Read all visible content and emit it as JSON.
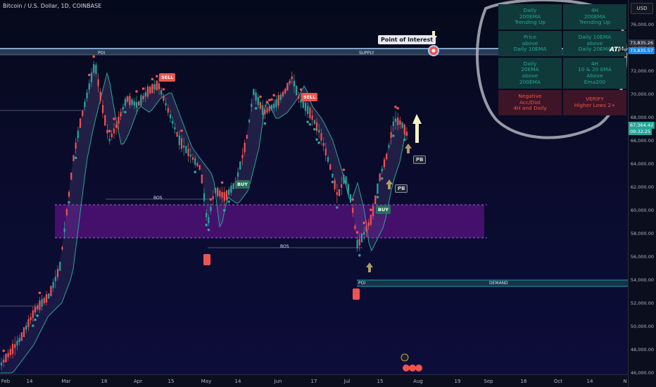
{
  "title": "Bitcoin / U.S. Dollar, 1D, COINBASE",
  "currency_button": "USD",
  "price_axis": [
    "76,000.00",
    "74,000.00",
    "72,000.00",
    "70,000.00",
    "68,000.00",
    "66,000.00",
    "64,000.00",
    "62,000.00",
    "60,000.00",
    "58,000.00",
    "56,000.00",
    "54,000.00",
    "52,000.00",
    "50,000.00",
    "48,000.00",
    "46,000.00"
  ],
  "price_tags": {
    "ath_price": "73,835.57",
    "top_price": "73,835.26",
    "current_price": "67,364.42",
    "countdown": "09:32:25"
  },
  "time_axis": [
    "Feb",
    "14",
    "Mar",
    "18",
    "Apr",
    "15",
    "May",
    "14",
    "Jun",
    "17",
    "Jul",
    "15",
    "Aug",
    "19",
    "Sep",
    "16",
    "Oct",
    "14",
    "N"
  ],
  "table": [
    {
      "text": "Daily\n200EMA\nTrending Up",
      "color": "green"
    },
    {
      "text": "4H\n200EMA\nTrending Up",
      "color": "green"
    },
    {
      "text": "Price\nabove\nDaily 10EMA",
      "color": "green"
    },
    {
      "text": "Daily 10EMA\nabove\nDaily 20EMA",
      "color": "green"
    },
    {
      "text": "Daily\n20EMA\nabove\n200EMA",
      "color": "green"
    },
    {
      "text": "4H\n10 & 20 EMA\nAbove\nEma200",
      "color": "green"
    },
    {
      "text": "Negative\nAcc/Dist\n4H and Daily",
      "color": "red"
    },
    {
      "text": "VERIFY\nHigher Lows 2+",
      "color": "red"
    }
  ],
  "labels": {
    "poi_callout": "Point of Interest",
    "poi_top": "POI",
    "supply": "SUPPLY",
    "poi_bottom": "POI",
    "demand": "DEMAND",
    "bos1": "BOS",
    "bos2": "BOS",
    "ath": "ATH",
    "high": "High",
    "sell1": "SELL",
    "sell2": "SELL",
    "buy1": "BUY",
    "buy2": "BUY",
    "pb1": "PB",
    "pb2": "PB"
  },
  "colors": {
    "bull": "#26a69a",
    "bear": "#ef5350",
    "accent": "#1e88e5",
    "zone": "#6a1b9a"
  }
}
